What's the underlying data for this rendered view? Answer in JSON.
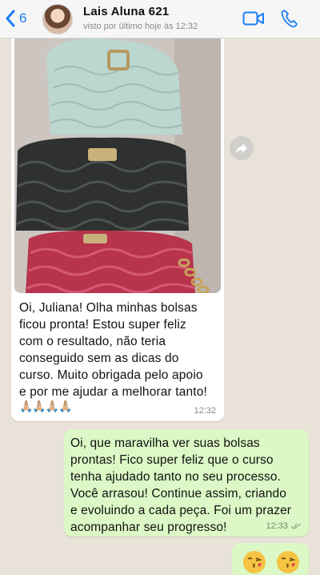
{
  "header": {
    "back_count": "6",
    "contact_name": "Lais  Aluna 621",
    "status": "visto por último hoje às 12:32"
  },
  "messages": {
    "incoming": {
      "text": "Oi, Juliana! Olha minhas bolsas\nficou pronta! Estou super feliz\ncom o resultado, não teria\nconseguido sem as dicas do\ncurso. Muito obrigada pelo apoio\ne por me ajudar a melhorar tanto!",
      "emoji": "🙏🏼🙏🏼🙏🏼🙏🏼",
      "time": "12:32"
    },
    "outgoing": {
      "text": "Oi, que maravilha ver suas bolsas\nprontas! Fico super feliz que o curso\ntenha ajudado tanto no seu processo.\nVocê arrasou! Continue assim, criando\ne evoluindo a cada peça. Foi um prazer\nacompanhar seu progresso!",
      "time": "12:33"
    }
  },
  "colors": {
    "ios_blue": "#1b7cf5",
    "bubble_outgoing": "#dcf8c6",
    "bubble_incoming": "#ffffff",
    "chat_bg": "#e9e2d8"
  },
  "icons": [
    "chevron-left-icon",
    "video-call-icon",
    "phone-icon",
    "forward-icon",
    "double-check-icon",
    "kiss-emoji-icon"
  ]
}
